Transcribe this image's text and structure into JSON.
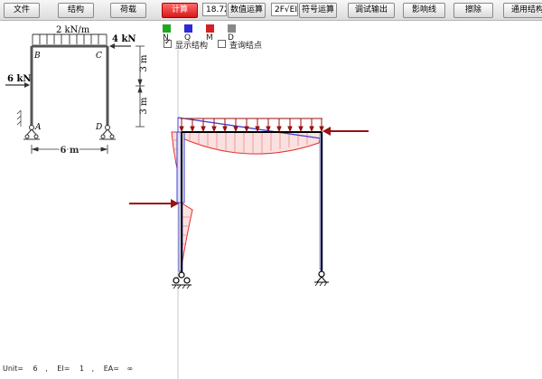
{
  "toolbar": {
    "file": "文件",
    "structure": "结构",
    "load": "荷载",
    "compute": "计算",
    "value": "18.72",
    "numeric": "数值运算",
    "formula": "2F√EI",
    "symbolic": "符号运算",
    "debug": "调试输出",
    "influence": "影响线",
    "erase": "擦除",
    "general": "通用结构"
  },
  "legend": {
    "n": "N",
    "q": "Q",
    "m": "M",
    "d": "D",
    "colors": {
      "n": "#1fa81f",
      "q": "#2a2ad8",
      "m": "#d42020",
      "d": "#888888"
    }
  },
  "options": {
    "show_structure": "显示结构",
    "show_structure_checked": true,
    "query_nodes": "查询结点",
    "query_nodes_checked": false
  },
  "figure": {
    "dist_load": "2 kN/m",
    "right_force": "4 kN",
    "left_force": "6 kN",
    "node_b": "B",
    "node_c": "C",
    "node_a": "A",
    "node_d": "D",
    "height_top": "3 m",
    "height_bottom": "3 m",
    "span": "6 m"
  },
  "status": {
    "unit_label": "Unit=",
    "unit_value": "6",
    "ei_label": "EI=",
    "ei_value": "1",
    "ea_label": "EA=",
    "ea_value": "∞"
  }
}
